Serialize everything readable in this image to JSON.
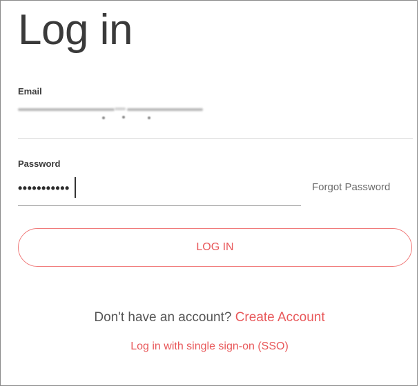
{
  "login": {
    "title": "Log in",
    "email": {
      "label": "Email",
      "value_obscured": true
    },
    "password": {
      "label": "Password",
      "masked_value": "•••••••••••"
    },
    "forgot_password_label": "Forgot Password",
    "login_button_label": "LOG IN",
    "signup_prompt": "Don't have an account?",
    "create_account_label": "Create Account",
    "sso_label": "Log in with single sign-on (SSO)"
  },
  "colors": {
    "accent": "#e8585a",
    "button_border": "#f07a7a",
    "text": "#3a3a3a"
  }
}
